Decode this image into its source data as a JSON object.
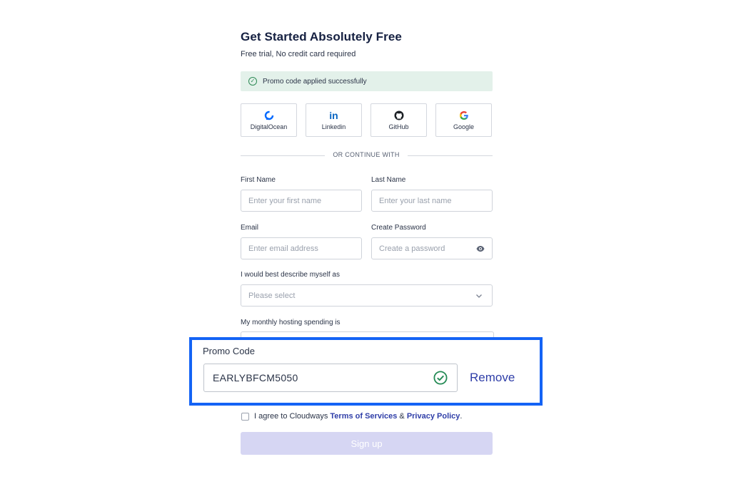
{
  "header": {
    "title": "Get Started Absolutely Free",
    "subtitle": "Free trial, No credit card required"
  },
  "promo_banner": {
    "text": "Promo code applied successfully",
    "icon": "check-circle-icon",
    "color": "#e3f1ea"
  },
  "social": [
    {
      "label": "DigitalOcean",
      "icon": "digitalocean-icon"
    },
    {
      "label": "Linkedin",
      "icon": "linkedin-icon"
    },
    {
      "label": "GitHub",
      "icon": "github-icon"
    },
    {
      "label": "Google",
      "icon": "google-icon"
    }
  ],
  "divider": "OR CONTINUE WITH",
  "form": {
    "first_name": {
      "label": "First Name",
      "placeholder": "Enter your first name"
    },
    "last_name": {
      "label": "Last Name",
      "placeholder": "Enter your last name"
    },
    "email": {
      "label": "Email",
      "placeholder": "Enter email address"
    },
    "password": {
      "label": "Create Password",
      "placeholder": "Create a password"
    },
    "describe": {
      "label": "I would best describe myself as",
      "placeholder": "Please select"
    },
    "spending": {
      "label": "My monthly hosting spending is"
    }
  },
  "promo": {
    "label": "Promo Code",
    "value": "EARLYBFCM5050",
    "remove_label": "Remove",
    "highlight_color": "#1463f5"
  },
  "agree": {
    "prefix": "I agree to Cloudways ",
    "terms": "Terms of Services",
    "and": " & ",
    "privacy": "Privacy Policy",
    "suffix": "."
  },
  "signup_label": "Sign up"
}
